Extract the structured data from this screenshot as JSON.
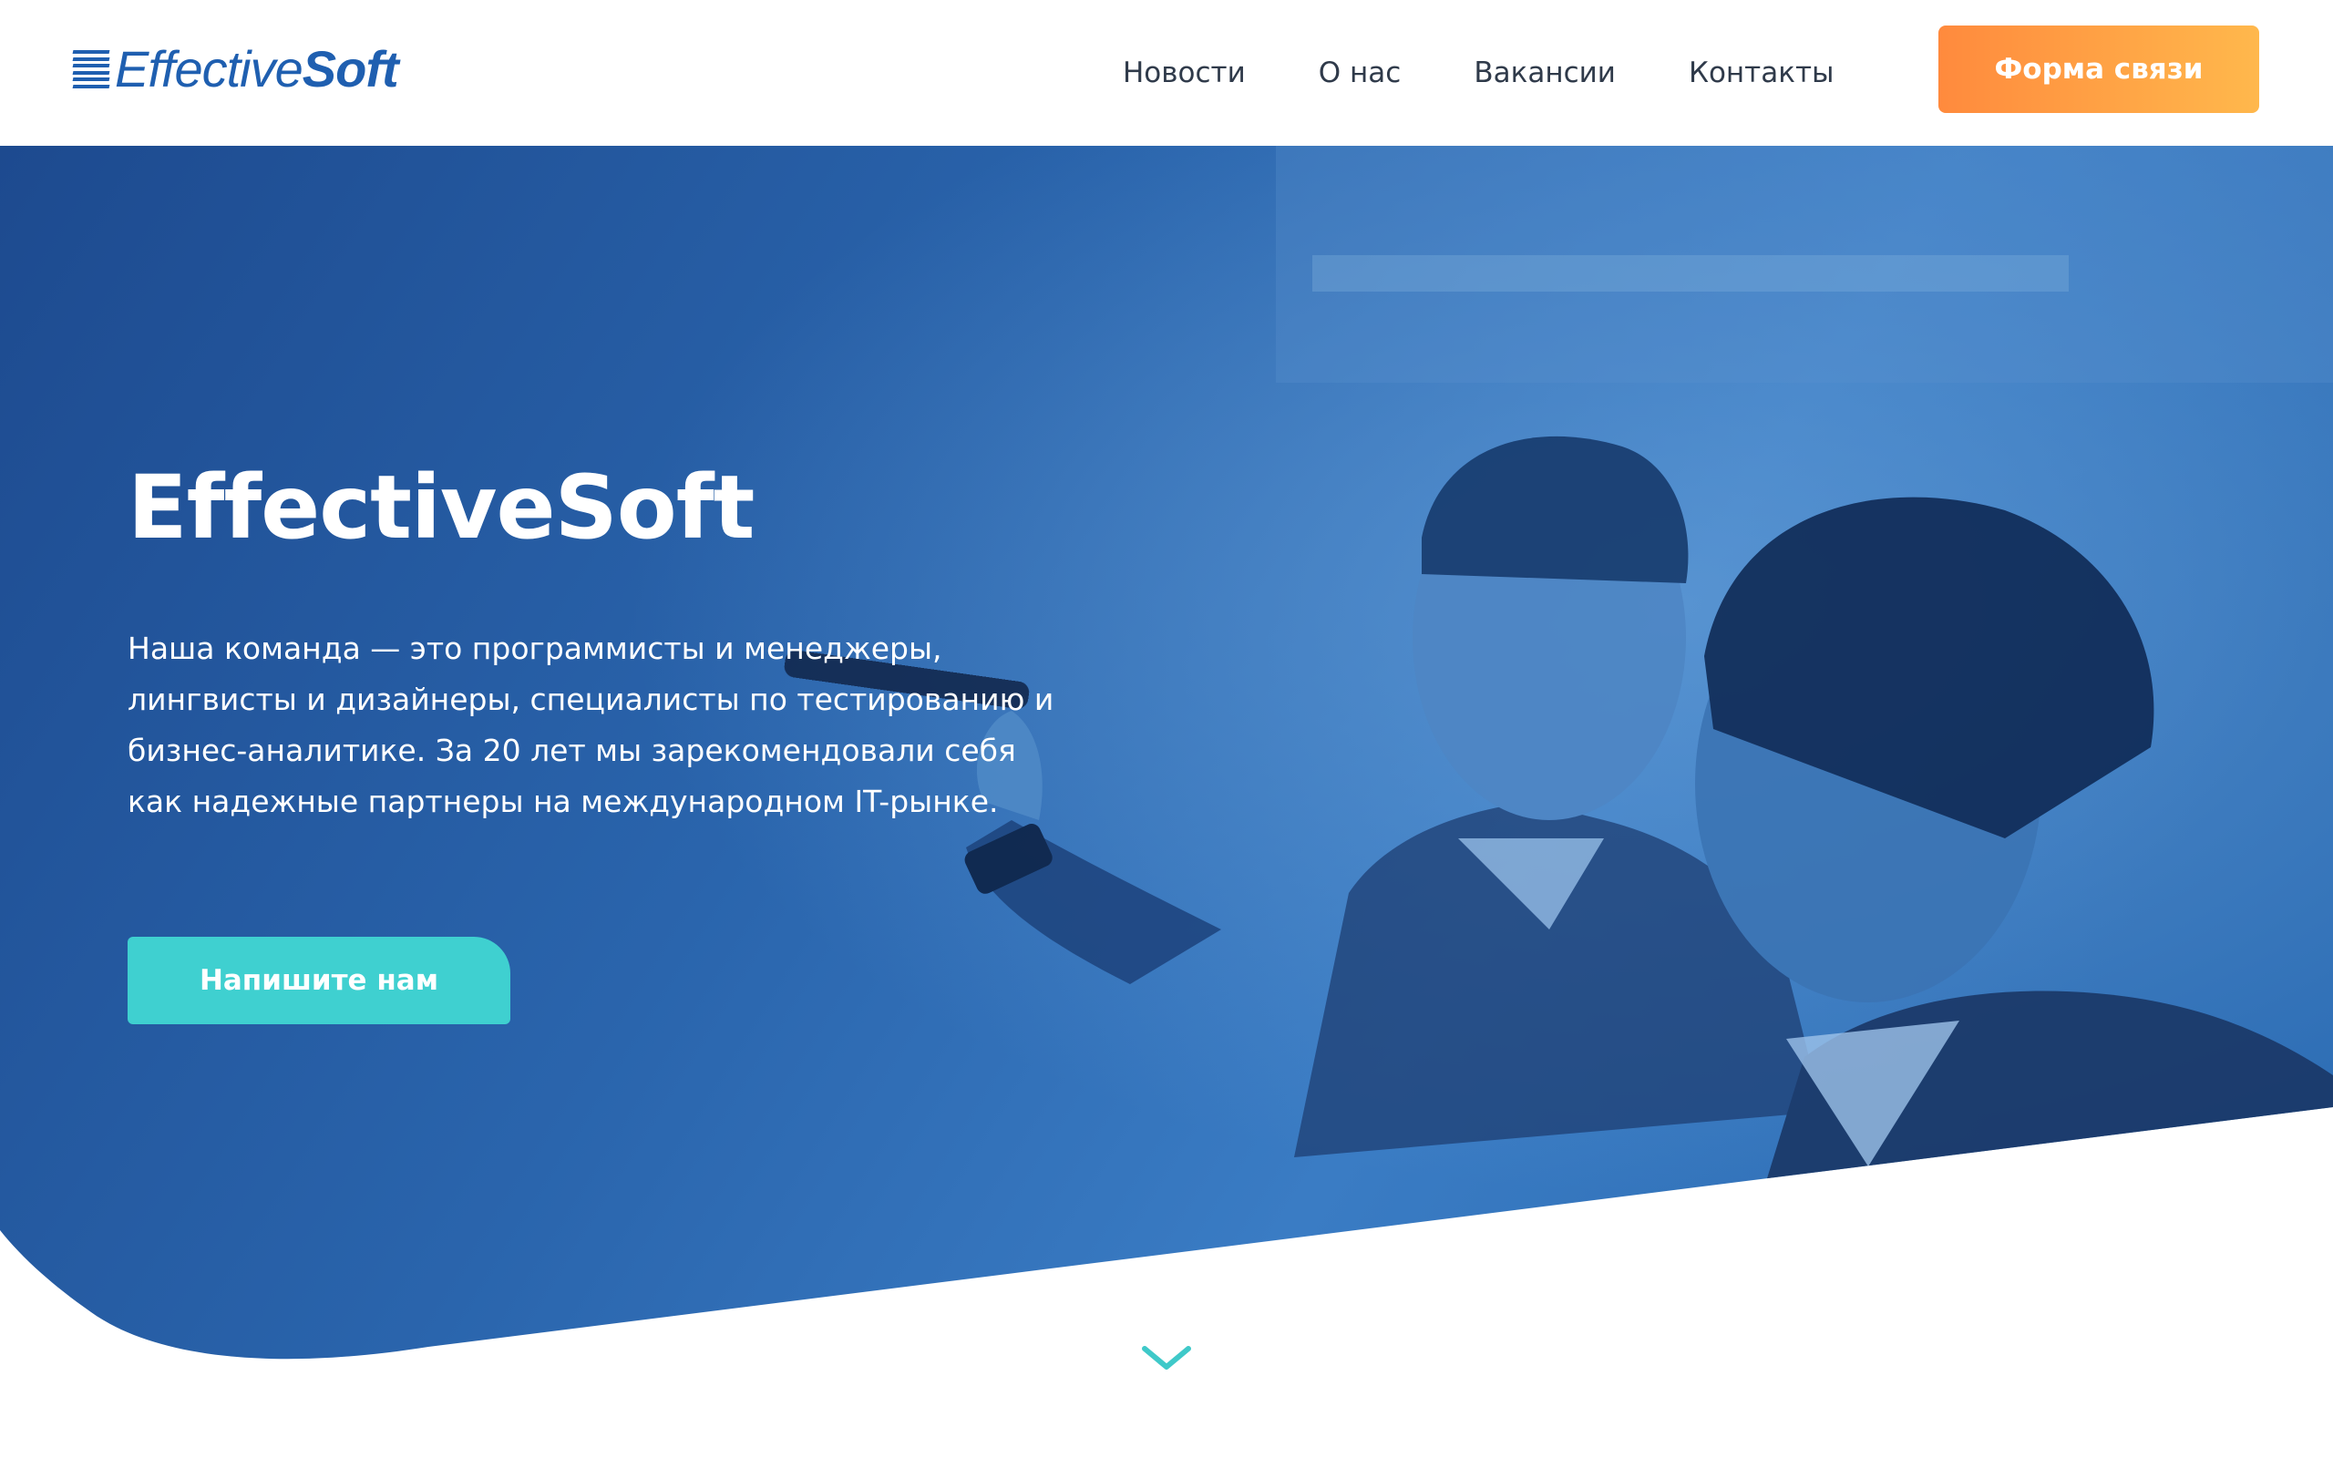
{
  "header": {
    "logo": {
      "part1": "Effective",
      "part2": "Soft"
    },
    "nav": [
      {
        "label": "Новости"
      },
      {
        "label": "О нас"
      },
      {
        "label": "Вакансии"
      },
      {
        "label": "Контакты"
      }
    ],
    "cta_label": "Форма связи"
  },
  "hero": {
    "title": "EffectiveSoft",
    "description": "Наша команда — это программисты и менеджеры, лингвисты и дизайнеры, специалисты по тестированию и бизнес-аналитике. За 20 лет мы зарекомендовали себя как надежные партнеры на международном IT-рынке.",
    "cta_label": "Напишите нам"
  },
  "scroll_indicator": {
    "icon": "chevron-down-icon"
  },
  "colors": {
    "brand_blue": "#1f5fb0",
    "hero_blue_dark": "#1d4a8f",
    "hero_blue_light": "#3c7fc8",
    "accent_orange": "#ff8a3d",
    "accent_teal": "#3fd0d0"
  }
}
